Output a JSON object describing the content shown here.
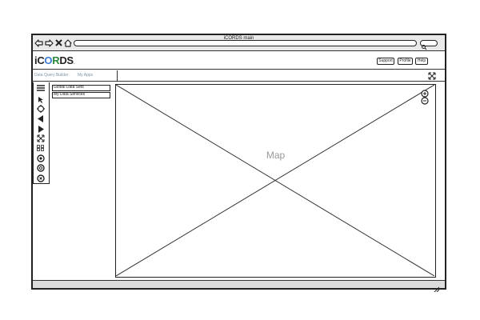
{
  "window": {
    "title": "iCORDS main"
  },
  "app": {
    "logo": {
      "text_i": "i",
      "text_c": "C",
      "text_o": "O",
      "text_r": "R",
      "text_ds": "DS",
      "tm": "."
    },
    "header_buttons": {
      "support": "Support",
      "profile": "Profile",
      "help": "Help"
    }
  },
  "menu": {
    "items": [
      "Data Query Builder",
      "My Apps"
    ]
  },
  "layers_panel": {
    "items": [
      "Global Data Sets",
      "My Data Services"
    ]
  },
  "map": {
    "label": "Map"
  },
  "icons": {
    "nav": [
      "back-arrow-icon",
      "forward-arrow-icon",
      "close-icon",
      "home-icon"
    ],
    "toolbar": [
      "menu-icon",
      "cursor-icon",
      "pan-icon",
      "previous-icon",
      "next-icon",
      "zoom-extent-icon",
      "select-area-icon",
      "layer-icon",
      "settings-icon",
      "info-icon"
    ],
    "zoom": [
      "zoom-in-icon",
      "zoom-out-icon"
    ]
  }
}
